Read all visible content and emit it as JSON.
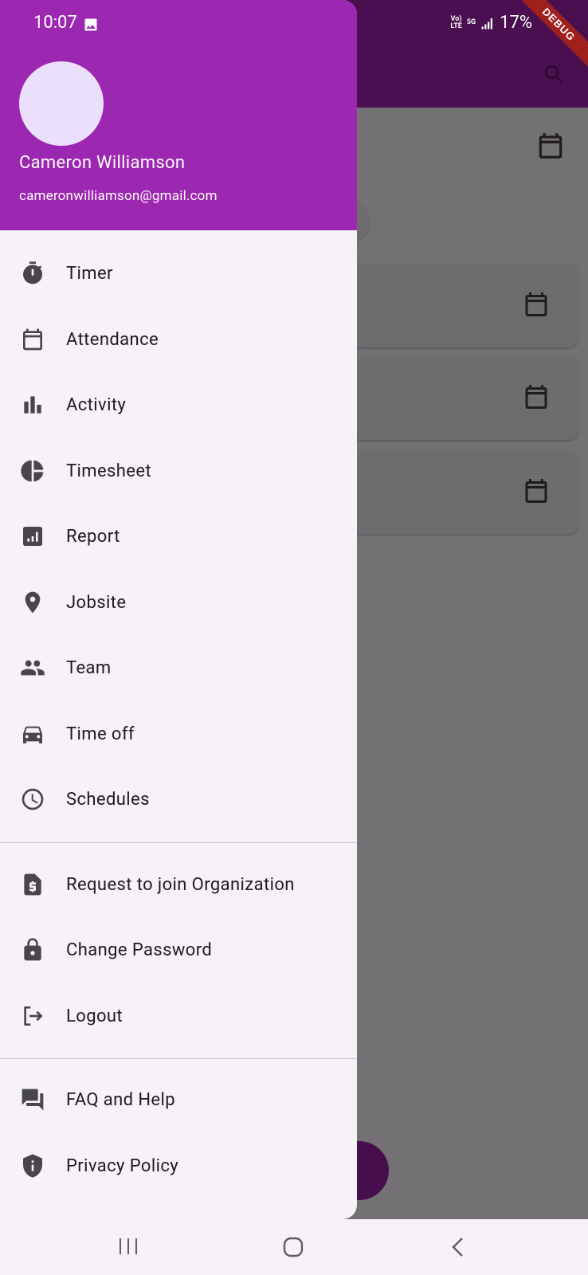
{
  "status_bar": {
    "time": "10:07",
    "volte": "Vo)) LTE",
    "network": "5G",
    "battery": "17%"
  },
  "debug_banner": "DEBUG",
  "user": {
    "name": "Cameron Williamson",
    "email": "cameronwilliamson@gmail.com"
  },
  "menu": {
    "main": [
      {
        "label": "Timer",
        "icon": "timer-icon"
      },
      {
        "label": "Attendance",
        "icon": "calendar-icon"
      },
      {
        "label": "Activity",
        "icon": "bar-chart-icon"
      },
      {
        "label": "Timesheet",
        "icon": "pie-chart-icon"
      },
      {
        "label": "Report",
        "icon": "report-icon"
      },
      {
        "label": "Jobsite",
        "icon": "location-pin-icon"
      },
      {
        "label": "Team",
        "icon": "people-icon"
      },
      {
        "label": "Time off",
        "icon": "car-icon"
      },
      {
        "label": "Schedules",
        "icon": "clock-icon"
      }
    ],
    "account": [
      {
        "label": "Request to join Organization",
        "icon": "request-document-icon"
      },
      {
        "label": "Change Password",
        "icon": "lock-icon"
      },
      {
        "label": "Logout",
        "icon": "logout-icon"
      }
    ],
    "help": [
      {
        "label": "FAQ and Help",
        "icon": "forum-icon"
      },
      {
        "label": "Privacy Policy",
        "icon": "shield-icon"
      }
    ]
  },
  "colors": {
    "header": "#9c27b0",
    "drawer_bg": "#f6f2f8",
    "scrim": "#747175",
    "app_bar": "#4a0f50"
  }
}
